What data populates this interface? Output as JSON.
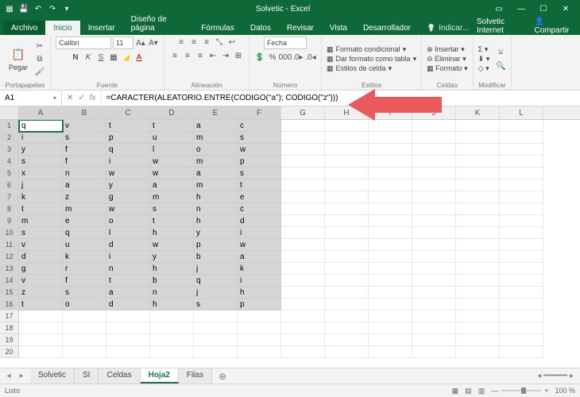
{
  "title": "Solvetic - Excel",
  "tabs": {
    "file": "Archivo",
    "home": "Inicio",
    "insert": "Insertar",
    "layout": "Diseño de página",
    "formulas": "Fórmulas",
    "data": "Datos",
    "review": "Revisar",
    "view": "Vista",
    "dev": "Desarrollador",
    "tell": "Indicar..."
  },
  "user": "Solvetic Internet",
  "share": "Compartir",
  "ribbon": {
    "clipboard": {
      "paste": "Pegar",
      "name": "Portapapeles"
    },
    "font": {
      "name": "Fuente",
      "family": "Calibri",
      "size": "11"
    },
    "align": {
      "name": "Alineación"
    },
    "number": {
      "name": "Número",
      "format": "Fecha"
    },
    "styles": {
      "name": "Estilos",
      "cond": "Formato condicional",
      "table": "Dar formato como tabla",
      "cell": "Estilos de celda"
    },
    "cells": {
      "name": "Celdas",
      "insert": "Insertar",
      "delete": "Eliminar",
      "format": "Formato"
    },
    "edit": {
      "name": "Modificar"
    }
  },
  "namebox": "A1",
  "formula": "=CARACTER(ALEATORIO.ENTRE(CODIGO(\"a\"); CODIGO(\"z\")))",
  "cols": [
    "A",
    "B",
    "C",
    "D",
    "E",
    "F",
    "G",
    "H",
    "I",
    "J",
    "K",
    "L"
  ],
  "data": [
    [
      "q",
      "v",
      "t",
      "t",
      "a",
      "c"
    ],
    [
      "i",
      "s",
      "p",
      "u",
      "m",
      "s"
    ],
    [
      "y",
      "f",
      "q",
      "l",
      "o",
      "w"
    ],
    [
      "s",
      "f",
      "i",
      "w",
      "m",
      "p"
    ],
    [
      "x",
      "n",
      "w",
      "w",
      "a",
      "s"
    ],
    [
      "j",
      "a",
      "y",
      "a",
      "m",
      "t"
    ],
    [
      "k",
      "z",
      "g",
      "m",
      "h",
      "e"
    ],
    [
      "t",
      "m",
      "w",
      "s",
      "n",
      "c"
    ],
    [
      "m",
      "e",
      "o",
      "t",
      "h",
      "d"
    ],
    [
      "s",
      "q",
      "l",
      "h",
      "y",
      "i"
    ],
    [
      "v",
      "u",
      "d",
      "w",
      "p",
      "w"
    ],
    [
      "d",
      "k",
      "i",
      "y",
      "b",
      "a"
    ],
    [
      "g",
      "r",
      "n",
      "h",
      "j",
      "k"
    ],
    [
      "v",
      "f",
      "t",
      "b",
      "q",
      "i"
    ],
    [
      "z",
      "s",
      "a",
      "n",
      "j",
      "h"
    ],
    [
      "t",
      "o",
      "d",
      "h",
      "s",
      "p"
    ]
  ],
  "sheets": [
    "Solvetic",
    "SI",
    "Celdas",
    "Hoja2",
    "Filas"
  ],
  "activeSheet": 3,
  "status": "Listo",
  "zoom": "100 %"
}
